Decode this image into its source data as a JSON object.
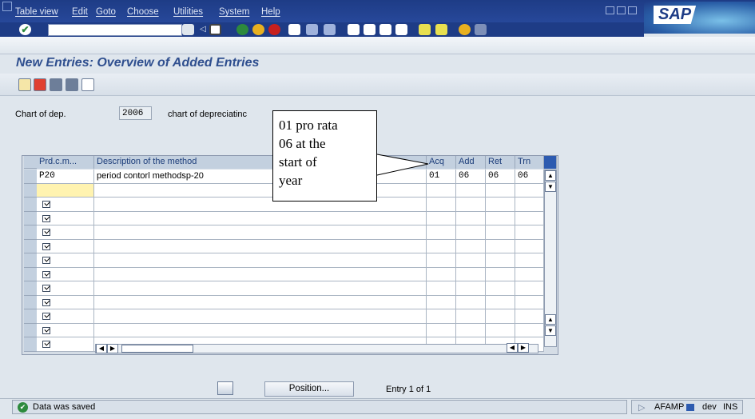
{
  "menu": [
    "Table view",
    "Edit",
    "Goto",
    "Choose",
    "Utilities",
    "System",
    "Help"
  ],
  "title": "New Entries: Overview of Added Entries",
  "header": {
    "chart_label": "Chart of dep.",
    "chart_value": "2006",
    "chart_desc": "chart of depreciatinc"
  },
  "table": {
    "columns": [
      "Prd.c.m...",
      "Description of the method",
      "Acq",
      "Add",
      "Ret",
      "Trn"
    ],
    "rows": [
      {
        "code": "P20",
        "desc": "period contorl methodsp-20",
        "acq": "01",
        "add": "06",
        "ret": "06",
        "trn": "06"
      }
    ]
  },
  "callout": [
    "01 pro rata",
    "06 at the",
    "start of",
    "year"
  ],
  "position_button": "Position...",
  "entry_info": "Entry 1 of 1",
  "status": {
    "message": "Data was saved",
    "system": "AFAMP",
    "client": "dev",
    "mode": "INS"
  },
  "logo": "SAP",
  "colors": {
    "menubar": "#1e3c86",
    "title": "#2f4f8f",
    "background": "#dfe6ed"
  }
}
